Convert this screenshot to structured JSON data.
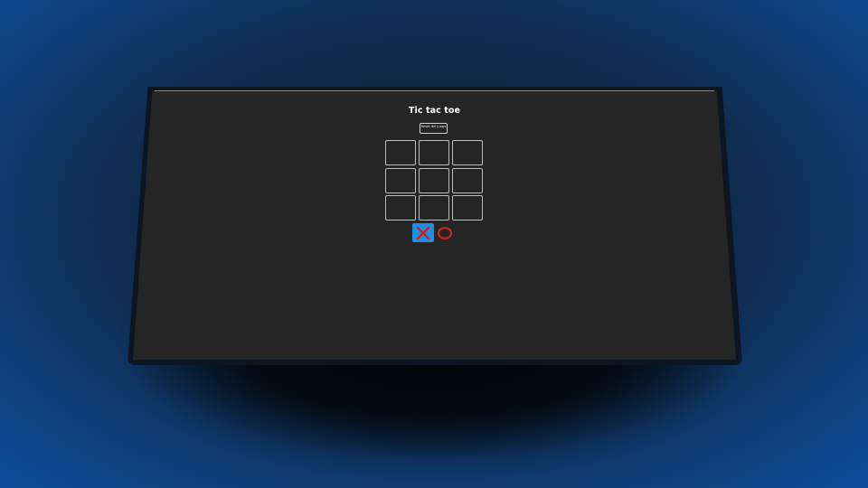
{
  "game": {
    "title": "Tic tac toe",
    "reset_label": "Reset del juego",
    "board": [
      "",
      "",
      "",
      "",
      "",
      "",
      "",
      "",
      ""
    ],
    "players": [
      {
        "symbol": "x-icon",
        "active": true
      },
      {
        "symbol": "o-icon",
        "active": false
      }
    ]
  },
  "colors": {
    "active_highlight": "#1a8fe3",
    "symbol_red": "#e0271f",
    "screen_bg": "#252525"
  }
}
